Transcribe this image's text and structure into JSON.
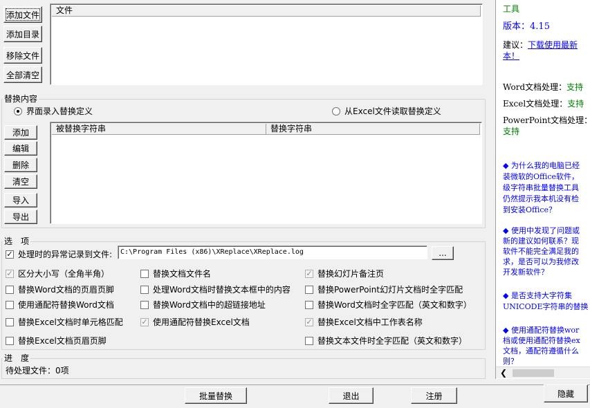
{
  "files": {
    "buttons": {
      "add_file": "添加文件",
      "add_dir": "添加目录",
      "remove_file": "移除文件",
      "clear_all": "全部清空"
    },
    "column_header": "文件"
  },
  "replace": {
    "group_title": "替换内容",
    "radio_ui": "界面录入替换定义",
    "radio_excel": "从Excel文件读取替换定义",
    "buttons": {
      "add": "添加",
      "edit": "编辑",
      "delete": "删除",
      "clear": "清空",
      "import": "导入",
      "export": "导出"
    },
    "col_find": "被替换字符串",
    "col_replace": "替换字符串"
  },
  "options": {
    "group_title": "选　项",
    "log_label": "处理时的异常记录到文件:",
    "log_path": "C:\\Program Files (x86)\\XReplace\\XReplace.log",
    "browse": "...",
    "items": [
      {
        "label": "区分大小写（全角半角）",
        "checked": true,
        "disabled": true
      },
      {
        "label": "替换文档文件名",
        "checked": false,
        "disabled": false
      },
      {
        "label": "替换幻灯片备注页",
        "checked": true,
        "disabled": true
      },
      {
        "label": "替换Word文档的页眉页脚",
        "checked": false,
        "disabled": false
      },
      {
        "label": "处理Word文档时替换文本框中的内容",
        "checked": false,
        "disabled": false
      },
      {
        "label": "替换PowerPoint幻灯片文档时全字匹配",
        "checked": false,
        "disabled": false
      },
      {
        "label": "使用通配符替换Word文档",
        "checked": false,
        "disabled": false
      },
      {
        "label": "替换Word文档中的超链接地址",
        "checked": false,
        "disabled": false
      },
      {
        "label": "替换Word文档时全字匹配（英文和数字）",
        "checked": false,
        "disabled": false
      },
      {
        "label": "替换Excel文档时单元格匹配",
        "checked": false,
        "disabled": false
      },
      {
        "label": "使用通配符替换Excel文档",
        "checked": true,
        "disabled": true
      },
      {
        "label": "替换Excel文档中工作表名称",
        "checked": true,
        "disabled": true
      },
      {
        "label": "替换Excel文档页眉页脚",
        "checked": false,
        "disabled": false
      },
      {
        "label": "替换文本文件时全字匹配（英文和数字）",
        "checked": false,
        "disabled": false
      }
    ]
  },
  "progress": {
    "group_title": "进　度",
    "pending_label": "待处理文件：0项"
  },
  "bottom": {
    "batch": "批量替换",
    "exit": "退出",
    "register": "注册",
    "hide": "隐藏"
  },
  "info": {
    "line_tool": "工具",
    "version_label": "版本：",
    "version": "4.15",
    "suggest_label": "建议：",
    "suggest_link1": "下载使用最新",
    "suggest_link2": "本！",
    "word_label": "Word文档处理：",
    "word_val": "支持",
    "excel_label": "Excel文档处理：",
    "excel_val": "支持",
    "ppt_label": "PowerPoint文档处理：",
    "ppt_val": "支持",
    "faq1": [
      "◆ 为什么我的电脑已经",
      "装微软的Office软件，",
      "级字符串批量替换工具",
      "仍然提示我本机没有检",
      "到安装Office？"
    ],
    "faq2": [
      "◆ 使用中发现了问题或",
      "新的建议如何联系？现",
      "软件不能完全满足我的",
      "求，是否可以为我修改",
      "开发新软件？"
    ],
    "faq3": [
      "◆ 是否支持大字符集",
      "UNICODE字符串的替换"
    ],
    "faq4": [
      "◆ 使用通配符替换wor",
      "档或使用通配符替换ex",
      "文档，通配符遵循什么",
      "则？"
    ]
  },
  "colors": {
    "green": "#008000",
    "blue": "#0000ff"
  }
}
